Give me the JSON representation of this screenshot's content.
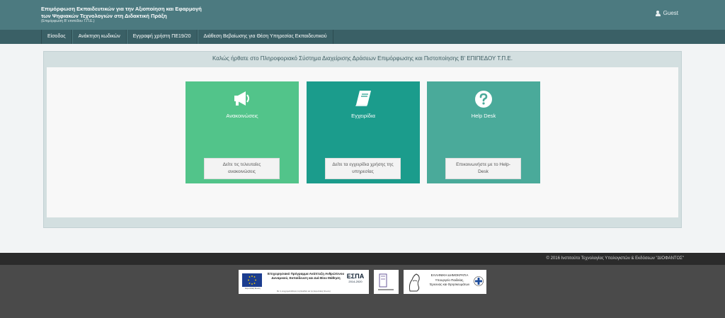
{
  "header": {
    "brand_line1": "Επιμόρφωση Εκπαιδευτικών για την Αξιοποίηση και Εφαρμογή",
    "brand_line2": "των Ψηφιακών Τεχνολογιών στη Διδακτική Πράξη",
    "brand_sub": "(Επιμόρφωση Β' επιπέδου Τ.Π.Ε.)",
    "user_label": "Guest",
    "user_icon": "user-icon"
  },
  "nav": {
    "items": [
      {
        "label": "Είσοδος"
      },
      {
        "label": "Ανάκτηση κωδικών"
      },
      {
        "label": "Εγγραφή χρήστη ΠΕ19/20"
      },
      {
        "label": "Διάθεση Βεβαίωσης για Θέση Υπηρεσίας Εκπαιδευτικού"
      }
    ]
  },
  "main": {
    "welcome": "Καλώς ήρθατε στο Πληροφοριακό Σύστημα Διαχείρισης Δράσεων Επιμόρφωσης και Πιστοποίησης Β' ΕΠΙΠΕΔΟΥ Τ.Π.Ε.",
    "cards": [
      {
        "title": "Ανακοινώσεις",
        "button": "Δείτε τις τελευταίες ανακοινώσεις",
        "icon": "megaphone-icon",
        "color": "#52c48a"
      },
      {
        "title": "Εγχειρίδια",
        "button": "Δείτε τα εγχειρίδια χρήσης της υπηρεσίας",
        "icon": "book-icon",
        "color": "#1b9c8c"
      },
      {
        "title": "Help Desk",
        "button": "Επικοινωνήστε με το Help-Desk",
        "icon": "question-circle-icon",
        "color": "#4aaa9a"
      }
    ]
  },
  "footer": {
    "copyright": "© 2016 Ινστιτούτο Τεχνολογίας Υπολογιστών & Εκδόσεων \"ΔΙΟΦΑΝΤΟΣ\"",
    "espa_title": "Επιχειρησιακό Πρόγραμμα Ανάπτυξη Ανθρώπινου Δυναμικού, Εκπαίδευση και Διά Βίου Μάθηση",
    "espa_footnote": "Με τη συγχρηματοδότηση της Ελλάδας και της Ευρωπαϊκής Ένωσης",
    "eu_label": "Ευρωπαϊκή Ένωση",
    "espa_logo": "ΕΣΠΑ",
    "espa_years": "2014-2020",
    "gr_line1": "ΕΛΛΗΝΙΚΗ ΔΗΜΟΚΡΑΤΙΑ",
    "gr_line2": "Υπουργείο Παιδείας,",
    "gr_line3": "Έρευνας και Θρησκευμάτων"
  }
}
